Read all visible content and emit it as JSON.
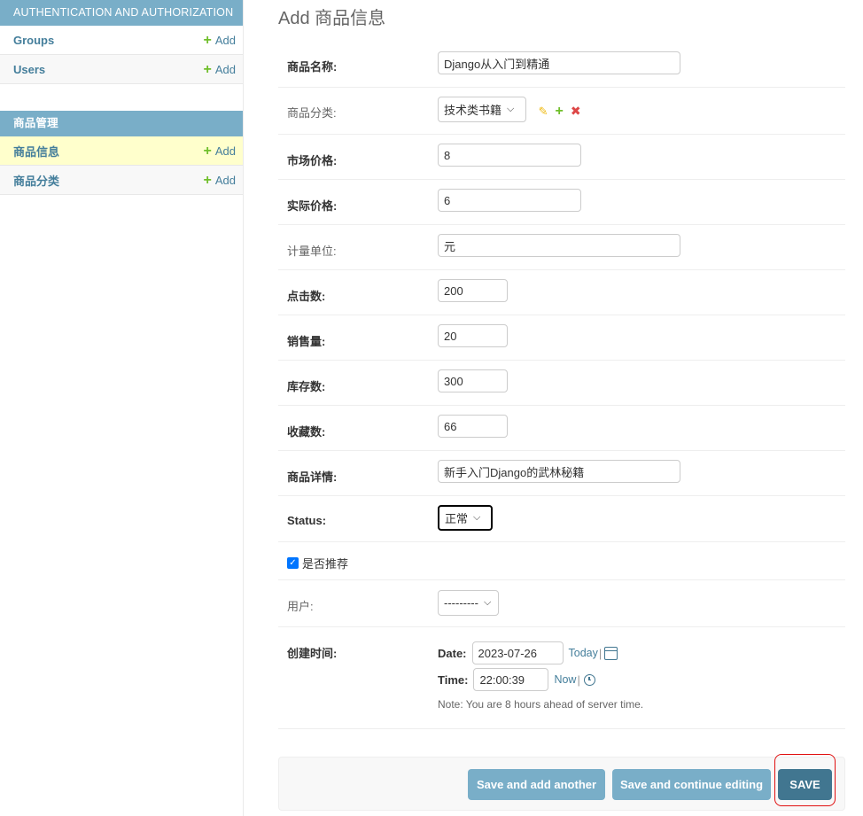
{
  "sidebar": {
    "modules": [
      {
        "caption": "AUTHENTICATION AND AUTHORIZATION",
        "rows": [
          {
            "name": "Groups",
            "add": "Add"
          },
          {
            "name": "Users",
            "add": "Add"
          }
        ]
      },
      {
        "caption": "商品管理",
        "rows": [
          {
            "name": "商品信息",
            "add": "Add"
          },
          {
            "name": "商品分类",
            "add": "Add"
          }
        ]
      }
    ]
  },
  "page": {
    "title": "Add 商品信息"
  },
  "fields": {
    "name": {
      "label": "商品名称:",
      "value": "Django从入门到精通"
    },
    "category": {
      "label": "商品分类:",
      "value": "技术类书籍"
    },
    "market_price": {
      "label": "市场价格:",
      "value": "8"
    },
    "actual_price": {
      "label": "实际价格:",
      "value": "6"
    },
    "unit": {
      "label": "计量单位:",
      "value": "元"
    },
    "clicks": {
      "label": "点击数:",
      "value": "200"
    },
    "sales": {
      "label": "销售量:",
      "value": "20"
    },
    "stock": {
      "label": "库存数:",
      "value": "300"
    },
    "favorites": {
      "label": "收藏数:",
      "value": "66"
    },
    "detail": {
      "label": "商品详情:",
      "value": "新手入门Django的武林秘籍"
    },
    "status": {
      "label": "Status:",
      "value": "正常"
    },
    "recommend": {
      "label": "是否推荐",
      "checked": true
    },
    "user": {
      "label": "用户:",
      "value": "---------"
    },
    "created": {
      "label": "创建时间:",
      "date_label": "Date:",
      "date_value": "2023-07-26",
      "today": "Today",
      "time_label": "Time:",
      "time_value": "22:00:39",
      "now": "Now",
      "sep": "|",
      "note": "Note: You are 8 hours ahead of server time."
    }
  },
  "buttons": {
    "save_add_another": "Save and add another",
    "save_continue": "Save and continue editing",
    "save": "SAVE"
  },
  "colors": {
    "module_caption": "#79aec8",
    "link": "#447e9b",
    "add_plus": "#70bf2b",
    "current_row": "#ffffcc",
    "save_button": "#417690",
    "highlight": "#e01010"
  },
  "icons": {
    "add": "plus-icon",
    "change": "pencil-icon",
    "delete": "x-icon",
    "calendar": "calendar-icon",
    "clock": "clock-icon"
  }
}
